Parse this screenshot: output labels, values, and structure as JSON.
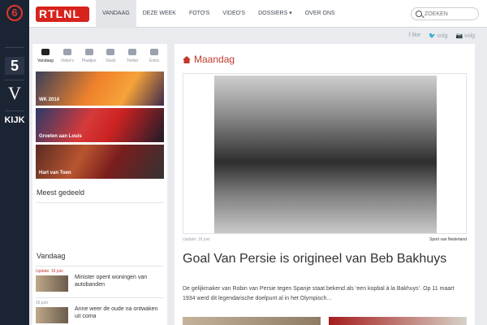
{
  "channels": {
    "six": "6",
    "five": "5",
    "veronica": "V",
    "kijk": "KIJK"
  },
  "header": {
    "logo_text": "RTLNL",
    "nav": [
      {
        "label": "VANDAAG",
        "active": true
      },
      {
        "label": "DEZE WEEK"
      },
      {
        "label": "FOTO'S"
      },
      {
        "label": "VIDEO'S"
      },
      {
        "label": "DOSSIERS"
      },
      {
        "label": "OVER ONS"
      }
    ],
    "search_placeholder": "ZOEKEN"
  },
  "social": {
    "like": "like",
    "follow1": "volg",
    "follow2": "volg"
  },
  "sidebar": {
    "tabs": [
      "Vandaag",
      "Video's",
      "Plaatjes",
      "Stuck",
      "Twitter",
      "Extra"
    ],
    "teasers": [
      {
        "label": "WK 2014"
      },
      {
        "label": "Groeten aan Louis"
      },
      {
        "label": "Hart van Toen"
      }
    ],
    "most_shared_title": "Meest gedeeld",
    "today_title": "Vandaag",
    "today_items": [
      {
        "date": "Update: 16 juni",
        "text": "Minister opent woningen van autobanden"
      },
      {
        "date": "16 juni",
        "text": "Anne weer de oude na ontwaken uit coma"
      }
    ]
  },
  "main": {
    "section_title": "Maandag",
    "photo_update": "Update: 16 juni",
    "photo_credit": "Sport van Nederland",
    "headline": "Goal Van Persie is origineel van Beb Bakhuys",
    "description": "De gelijkmaker van Robin van Persie tegen Spanje staat bekend als ‘een kopbal à la Bakhuys’. Op 11 maart 1934 werd dit legendarische doelpunt al in het Olympisch..."
  }
}
